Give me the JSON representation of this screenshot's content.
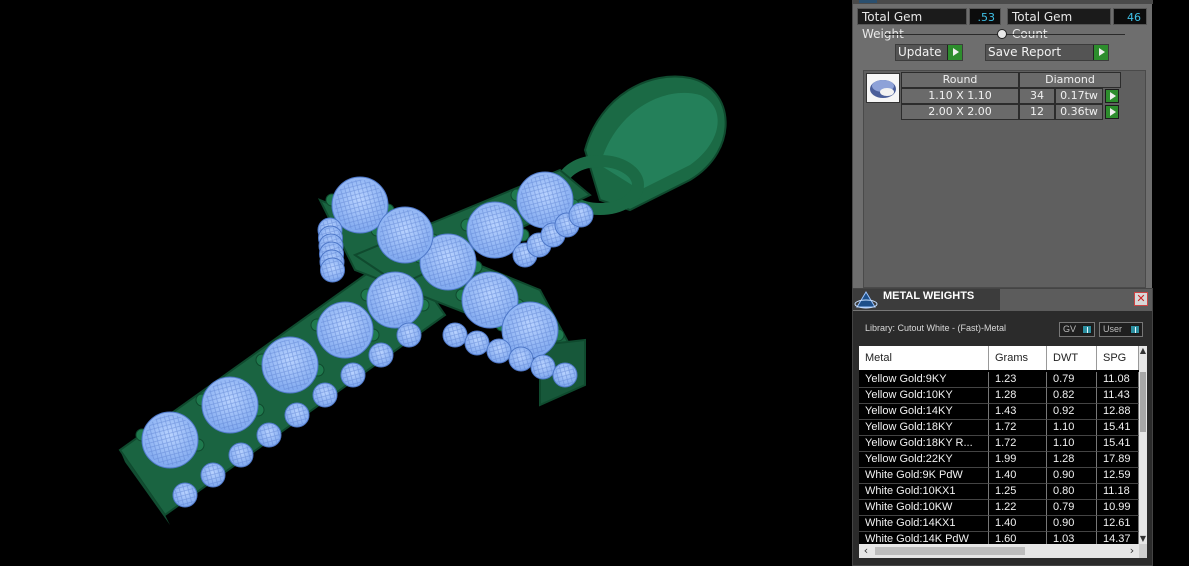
{
  "colors": {
    "metal": "#1d6b44",
    "gem": "#8bb6f7",
    "accent_green": "#2d8d2d",
    "value_text": "#3fc0e6"
  },
  "gem_summary": {
    "total_weight_label": "Total Gem Weight",
    "total_weight_value": ".53",
    "total_count_label": "Total Gem Count",
    "total_count_value": "46",
    "update_label": "Update",
    "save_report_label": "Save Report"
  },
  "gem_table": {
    "shape_header": "Round",
    "type_header": "Diamond",
    "thumb_icon": "round-gem-icon",
    "rows": [
      {
        "size": "1.10 X 1.10",
        "count": "34",
        "weight": "0.17tw"
      },
      {
        "size": "2.00 X 2.00",
        "count": "12",
        "weight": "0.36tw"
      }
    ]
  },
  "metal_weights": {
    "title": "METAL WEIGHTS",
    "library_label": "Library: Cutout White - (Fast)-Metal",
    "gv_label": "GV",
    "user_label": "User",
    "close_icon": "close-icon",
    "app_icon": "triangle-logo-icon",
    "columns": [
      "Metal",
      "Grams",
      "DWT",
      "SPG"
    ],
    "rows": [
      {
        "metal": "Yellow Gold:9KY",
        "grams": "1.23",
        "dwt": "0.79",
        "spg": "11.08"
      },
      {
        "metal": "Yellow Gold:10KY",
        "grams": "1.28",
        "dwt": "0.82",
        "spg": "11.43"
      },
      {
        "metal": "Yellow Gold:14KY",
        "grams": "1.43",
        "dwt": "0.92",
        "spg": "12.88"
      },
      {
        "metal": "Yellow Gold:18KY",
        "grams": "1.72",
        "dwt": "1.10",
        "spg": "15.41"
      },
      {
        "metal": "Yellow Gold:18KY R...",
        "grams": "1.72",
        "dwt": "1.10",
        "spg": "15.41"
      },
      {
        "metal": "Yellow Gold:22KY",
        "grams": "1.99",
        "dwt": "1.28",
        "spg": "17.89"
      },
      {
        "metal": "White Gold:9K PdW",
        "grams": "1.40",
        "dwt": "0.90",
        "spg": "12.59"
      },
      {
        "metal": "White Gold:10KX1",
        "grams": "1.25",
        "dwt": "0.80",
        "spg": "11.18"
      },
      {
        "metal": "White Gold:10KW",
        "grams": "1.22",
        "dwt": "0.79",
        "spg": "10.99"
      },
      {
        "metal": "White Gold:14KX1",
        "grams": "1.40",
        "dwt": "0.90",
        "spg": "12.61"
      },
      {
        "metal": "White Gold:14K PdW",
        "grams": "1.60",
        "dwt": "1.03",
        "spg": "14.37"
      }
    ]
  }
}
